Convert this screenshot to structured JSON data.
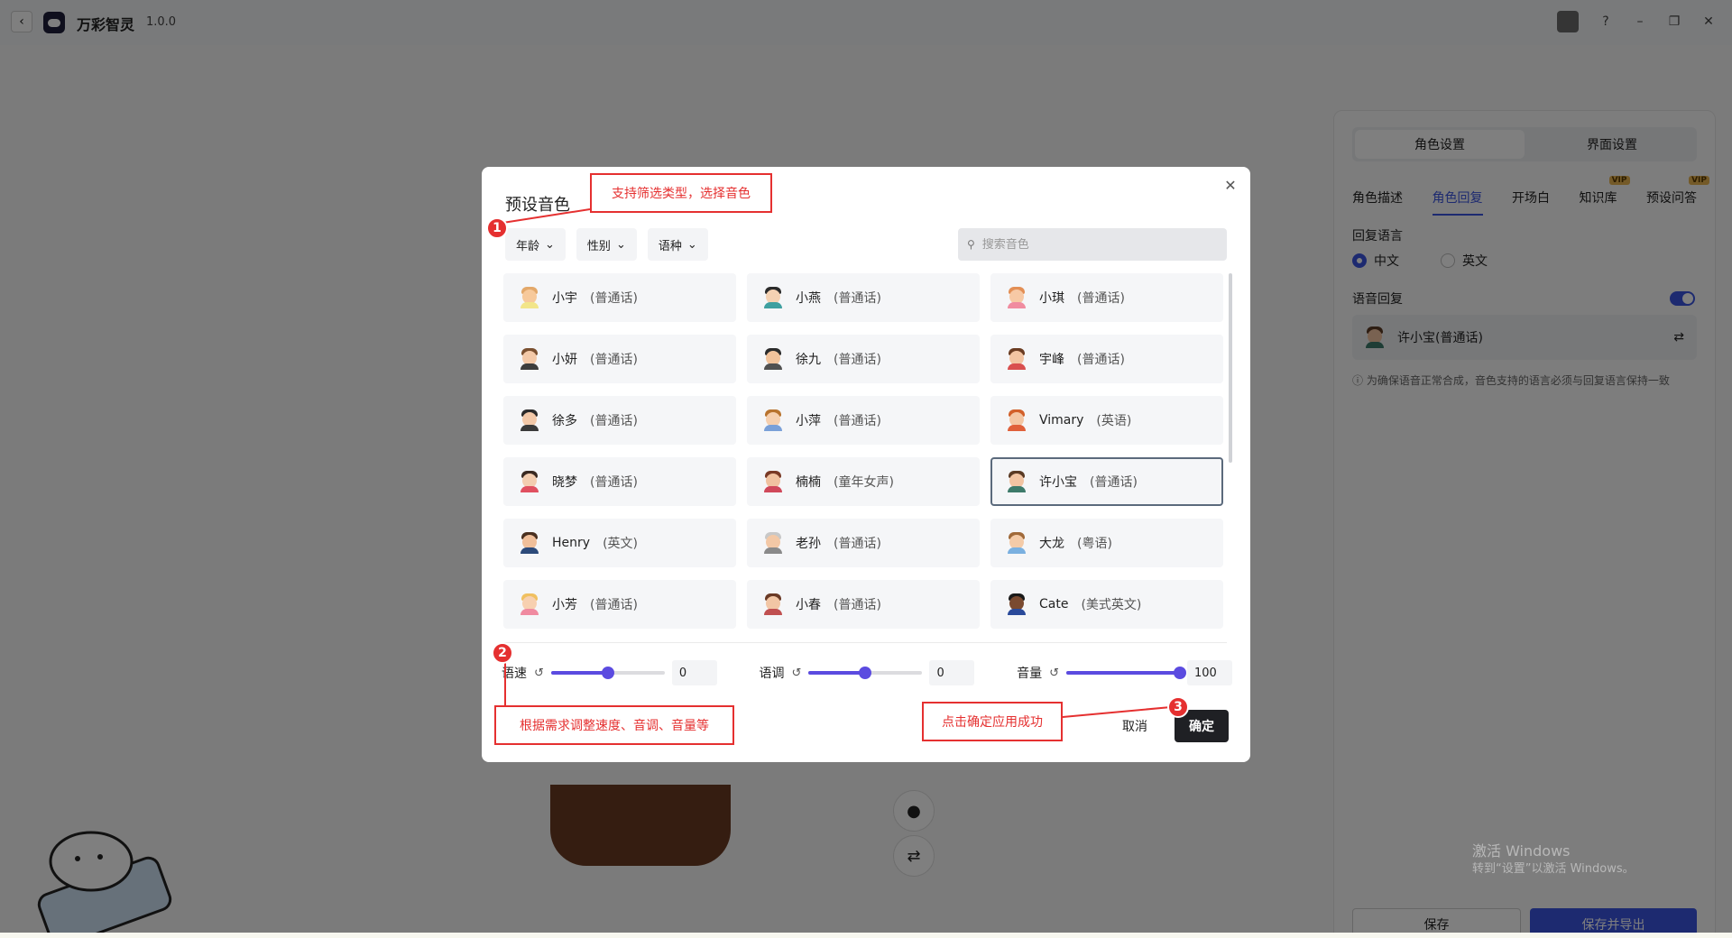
{
  "app": {
    "name": "万彩智灵",
    "version": "1.0.0"
  },
  "right_panel": {
    "tabs": [
      "角色设置",
      "界面设置"
    ],
    "subtabs": [
      {
        "label": "角色描述",
        "vip": ""
      },
      {
        "label": "角色回复",
        "vip": ""
      },
      {
        "label": "开场白",
        "vip": ""
      },
      {
        "label": "知识库",
        "vip": "VIP"
      },
      {
        "label": "预设问答",
        "vip": "VIP"
      }
    ],
    "reply_language_label": "回复语言",
    "lang_zh": "中文",
    "lang_en": "英文",
    "voice_reply_label": "语音回复",
    "current_voice": "许小宝(普通话)",
    "note": "为确保语音正常合成，音色支持的语言必须与回复语言保持一致",
    "save_label": "保存",
    "export_label": "保存并导出"
  },
  "dialog": {
    "title": "预设音色",
    "filters": [
      "年龄",
      "性别",
      "语种"
    ],
    "search_placeholder": "搜索音色",
    "voices": [
      {
        "name": "小宇",
        "tag": "(普通话)",
        "hair": "#e3a86a",
        "face": "#f7c99b",
        "body": "#f2e58a",
        "selected": false
      },
      {
        "name": "小燕",
        "tag": "(普通话)",
        "hair": "#2b2b2b",
        "face": "#f5d2b3",
        "body": "#3fa0a0",
        "selected": false
      },
      {
        "name": "小琪",
        "tag": "(普通话)",
        "hair": "#e38f55",
        "face": "#f7c9a5",
        "body": "#f08ca0",
        "selected": false
      },
      {
        "name": "小妍",
        "tag": "(普通话)",
        "hair": "#7a5030",
        "face": "#f3c9a8",
        "body": "#3d3d3d",
        "selected": false
      },
      {
        "name": "徐九",
        "tag": "(普通话)",
        "hair": "#2b2b2b",
        "face": "#f2c39b",
        "body": "#505050",
        "selected": false
      },
      {
        "name": "宇峰",
        "tag": "(普通话)",
        "hair": "#6b3c22",
        "face": "#f3c4a2",
        "body": "#d94f4f",
        "selected": false
      },
      {
        "name": "徐多",
        "tag": "(普通话)",
        "hair": "#2b2b2b",
        "face": "#f2c8a8",
        "body": "#3a3a3a",
        "selected": false
      },
      {
        "name": "小萍",
        "tag": "(普通话)",
        "hair": "#b8732e",
        "face": "#f6cfae",
        "body": "#7aa0d8",
        "selected": false
      },
      {
        "name": "Vimary",
        "tag": "(英语)",
        "hair": "#d2602a",
        "face": "#f4c6a3",
        "body": "#e0603a",
        "selected": false
      },
      {
        "name": "晓梦",
        "tag": "(普通话)",
        "hair": "#3a2a22",
        "face": "#f3cdb0",
        "body": "#e05060",
        "selected": false
      },
      {
        "name": "楠楠",
        "tag": "(童年女声)",
        "hair": "#7a3a26",
        "face": "#f1c2a0",
        "body": "#d0485a",
        "selected": false
      },
      {
        "name": "许小宝",
        "tag": "(普通话)",
        "hair": "#5a3a24",
        "face": "#f2c4a2",
        "body": "#3d7a6a",
        "selected": true
      },
      {
        "name": "Henry",
        "tag": "(英文)",
        "hair": "#4a3020",
        "face": "#f0bf9a",
        "body": "#2c4a7a",
        "selected": false
      },
      {
        "name": "老孙",
        "tag": "(普通话)",
        "hair": "#c8c8c8",
        "face": "#f3c8a6",
        "body": "#8a8a8a",
        "selected": false
      },
      {
        "name": "大龙",
        "tag": "(粤语)",
        "hair": "#a06a3a",
        "face": "#f4cba8",
        "body": "#7ab0e0",
        "selected": false
      },
      {
        "name": "小芳",
        "tag": "(普通话)",
        "hair": "#f0c060",
        "face": "#f7d0b0",
        "body": "#f08aa0",
        "selected": false
      },
      {
        "name": "小春",
        "tag": "(普通话)",
        "hair": "#6a3a26",
        "face": "#f2c6a5",
        "body": "#c05050",
        "selected": false
      },
      {
        "name": "Cate",
        "tag": "(美式英文)",
        "hair": "#1a1a1a",
        "face": "#7a4a30",
        "body": "#2a4a9a",
        "selected": false
      }
    ],
    "sliders": [
      {
        "label": "语速",
        "value": "0",
        "level": 0.5
      },
      {
        "label": "语调",
        "value": "0",
        "level": 0.5
      },
      {
        "label": "音量",
        "value": "100",
        "level": 1.0
      }
    ],
    "cancel_label": "取消",
    "ok_label": "确定"
  },
  "annotations": {
    "one": {
      "num": "1",
      "text": "支持筛选类型，选择音色"
    },
    "two": {
      "num": "2",
      "text": "根据需求调整速度、音调、音量等"
    },
    "three": {
      "num": "3",
      "text": "点击确定应用成功"
    }
  },
  "watermark": {
    "line1": "激活 Windows",
    "line2": "转到“设置”以激活 Windows。"
  },
  "colors": {
    "accent": "#5b4be0",
    "annotation": "#e53030",
    "primary_button": "#1f2024"
  }
}
